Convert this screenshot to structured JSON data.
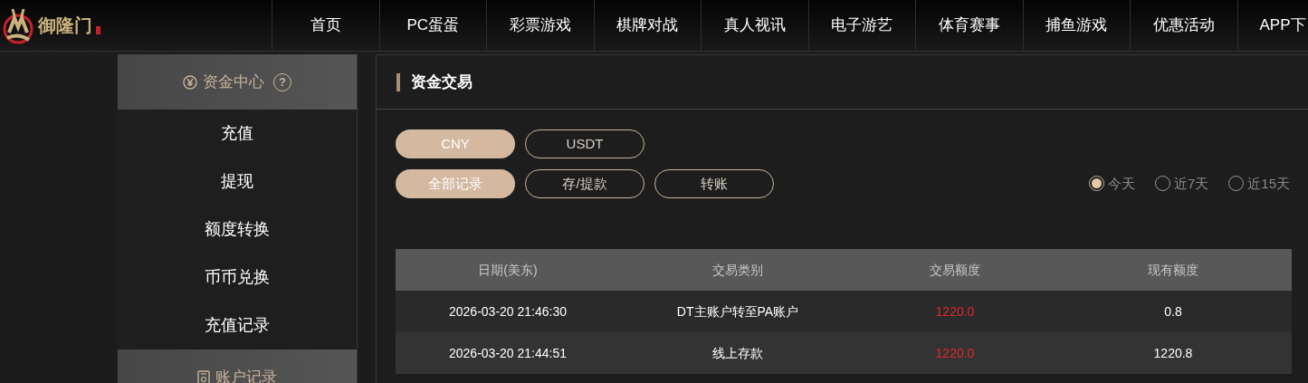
{
  "logo": {
    "text": "御隆门"
  },
  "nav": [
    {
      "label": "首页"
    },
    {
      "label": "PC蛋蛋"
    },
    {
      "label": "彩票游戏"
    },
    {
      "label": "棋牌对战"
    },
    {
      "label": "真人视讯"
    },
    {
      "label": "电子游艺"
    },
    {
      "label": "体育赛事"
    },
    {
      "label": "捕鱼游戏"
    },
    {
      "label": "优惠活动"
    },
    {
      "label": "APP下"
    }
  ],
  "sidebar": {
    "sections": [
      {
        "title": "资金中心",
        "help": "?",
        "items": [
          {
            "label": "充值"
          },
          {
            "label": "提现"
          },
          {
            "label": "额度转换"
          },
          {
            "label": "币币兑换"
          },
          {
            "label": "充值记录"
          }
        ]
      },
      {
        "title": "账户记录"
      }
    ]
  },
  "panel": {
    "title": "资金交易",
    "currency_tabs": [
      {
        "label": "CNY",
        "selected": true
      },
      {
        "label": "USDT",
        "selected": false
      }
    ],
    "record_tabs": [
      {
        "label": "全部记录",
        "selected": true
      },
      {
        "label": "存/提款",
        "selected": false
      },
      {
        "label": "转账",
        "selected": false
      }
    ],
    "periods": [
      {
        "label": "今天",
        "selected": true
      },
      {
        "label": "近7天",
        "selected": false
      },
      {
        "label": "近15天",
        "selected": false
      }
    ],
    "table": {
      "columns": [
        "日期(美东)",
        "交易类别",
        "交易额度",
        "现有额度"
      ],
      "rows": [
        [
          "2026-03-20 21:46:30",
          "DT主账户转至PA账户",
          "1220.0",
          "0.8"
        ],
        [
          "2026-03-20 21:44:51",
          "线上存款",
          "1220.0",
          "1220.8"
        ]
      ]
    }
  }
}
